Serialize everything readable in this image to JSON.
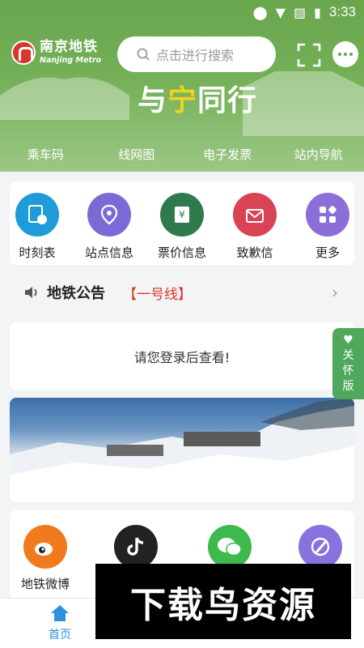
{
  "status": {
    "time": "3:33"
  },
  "header": {
    "logo_cn": "南京地铁",
    "logo_en": "Nanjing Metro",
    "search_placeholder": "点击进行搜索",
    "slogan_a": "与",
    "slogan_b": "宁",
    "slogan_c": "同行",
    "quick": [
      {
        "label": "乘车码"
      },
      {
        "label": "线网图"
      },
      {
        "label": "电子发票"
      },
      {
        "label": "站内导航"
      }
    ]
  },
  "services": [
    {
      "label": "时刻表",
      "color": "#1e9bd8"
    },
    {
      "label": "站点信息",
      "color": "#7b6ad6"
    },
    {
      "label": "票价信息",
      "color": "#2f7a4c"
    },
    {
      "label": "致歉信",
      "color": "#d84356"
    },
    {
      "label": "更多",
      "color": "#8a6fd8"
    }
  ],
  "notice": {
    "title": "地铁公告",
    "line": "【一号线】"
  },
  "login_prompt": "请您登录后查看!",
  "care_mode": "关怀版",
  "social": [
    {
      "label": "地铁微博",
      "color": "#f07a1e"
    },
    {
      "label": "",
      "color": "#222222"
    },
    {
      "label": "",
      "color": "#3fb84e"
    },
    {
      "label": "",
      "color": "#8a72de"
    }
  ],
  "tabs": [
    {
      "label": "首页",
      "active": true
    }
  ],
  "watermark": "下载鸟资源"
}
